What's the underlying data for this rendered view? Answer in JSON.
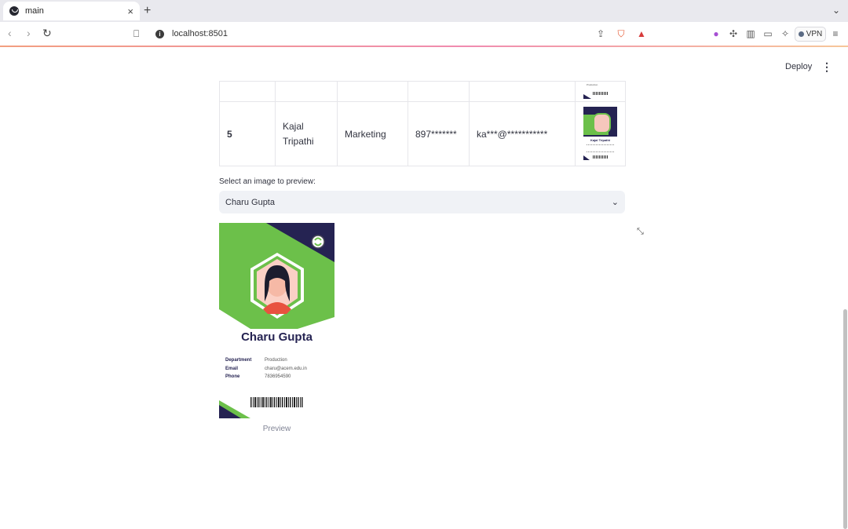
{
  "browser": {
    "tab_title": "main",
    "tab_close": "×",
    "new_tab": "+",
    "url": "localhost:8501",
    "vpn_label": "VPN",
    "brave_badge": "1",
    "alert_badge": "1"
  },
  "app": {
    "deploy_label": "Deploy"
  },
  "table": {
    "rows": [
      {
        "id": "",
        "name": "",
        "department": "",
        "phone": "",
        "email": "",
        "image_name": "",
        "image_dept": "Production"
      },
      {
        "id": "5",
        "name": "Kajal Tripathi",
        "department": "Marketing",
        "phone": "897*******",
        "email": "ka***@***********",
        "image_name": "Kajal Tripathi",
        "image_dept": "Marketing"
      }
    ]
  },
  "preview": {
    "select_label": "Select an image to preview:",
    "selected": "Charu Gupta",
    "caption": "Preview",
    "card": {
      "name": "Charu Gupta",
      "fields": [
        {
          "key": "Department",
          "value": "Production"
        },
        {
          "key": "Email",
          "value": "charu@acem.edu.in"
        },
        {
          "key": "Phone",
          "value": "7836954590"
        }
      ]
    }
  },
  "colors": {
    "card_navy": "#252352",
    "card_green": "#6cc04a",
    "select_bg": "#f0f2f6"
  }
}
